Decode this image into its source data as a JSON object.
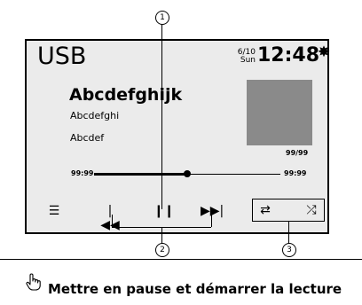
{
  "header": {
    "source": "USB",
    "date_top": "6/10",
    "date_bottom": "Sun",
    "clock": "12:48"
  },
  "track": {
    "title": "Abcdefghijk",
    "artist": "Abcdefghi",
    "album": "Abcdef",
    "track_number": "99/99"
  },
  "progress": {
    "elapsed": "99:99",
    "total": "99:99",
    "fraction": 0.5
  },
  "callouts": {
    "c1": "1",
    "c2": "2",
    "c3": "3"
  },
  "footer": {
    "caption": "Mettre en pause et démarrer la lecture"
  },
  "icons": {
    "settings": "gear-icon",
    "menu": "list-icon",
    "prev": "skip-previous-icon",
    "pause": "pause-icon",
    "next": "skip-next-icon",
    "repeat": "repeat-icon",
    "shuffle": "shuffle-icon",
    "hand": "pointing-hand-icon"
  }
}
